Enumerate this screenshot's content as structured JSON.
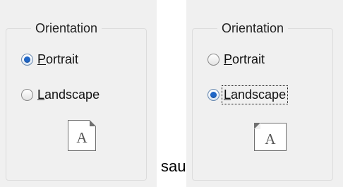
{
  "left_panel": {
    "group_title": "Orientation",
    "portrait": {
      "label_mn": "P",
      "label_rest": "ortrait",
      "checked": true
    },
    "landscape": {
      "label_mn": "L",
      "label_rest": "andscape",
      "checked": false
    },
    "preview_letter": "A"
  },
  "right_panel": {
    "group_title": "Orientation",
    "portrait": {
      "label_mn": "P",
      "label_rest": "ortrait",
      "checked": false
    },
    "landscape": {
      "label_mn": "L",
      "label_rest": "andscape",
      "checked": true
    },
    "preview_letter": "A"
  },
  "caption": "sau"
}
